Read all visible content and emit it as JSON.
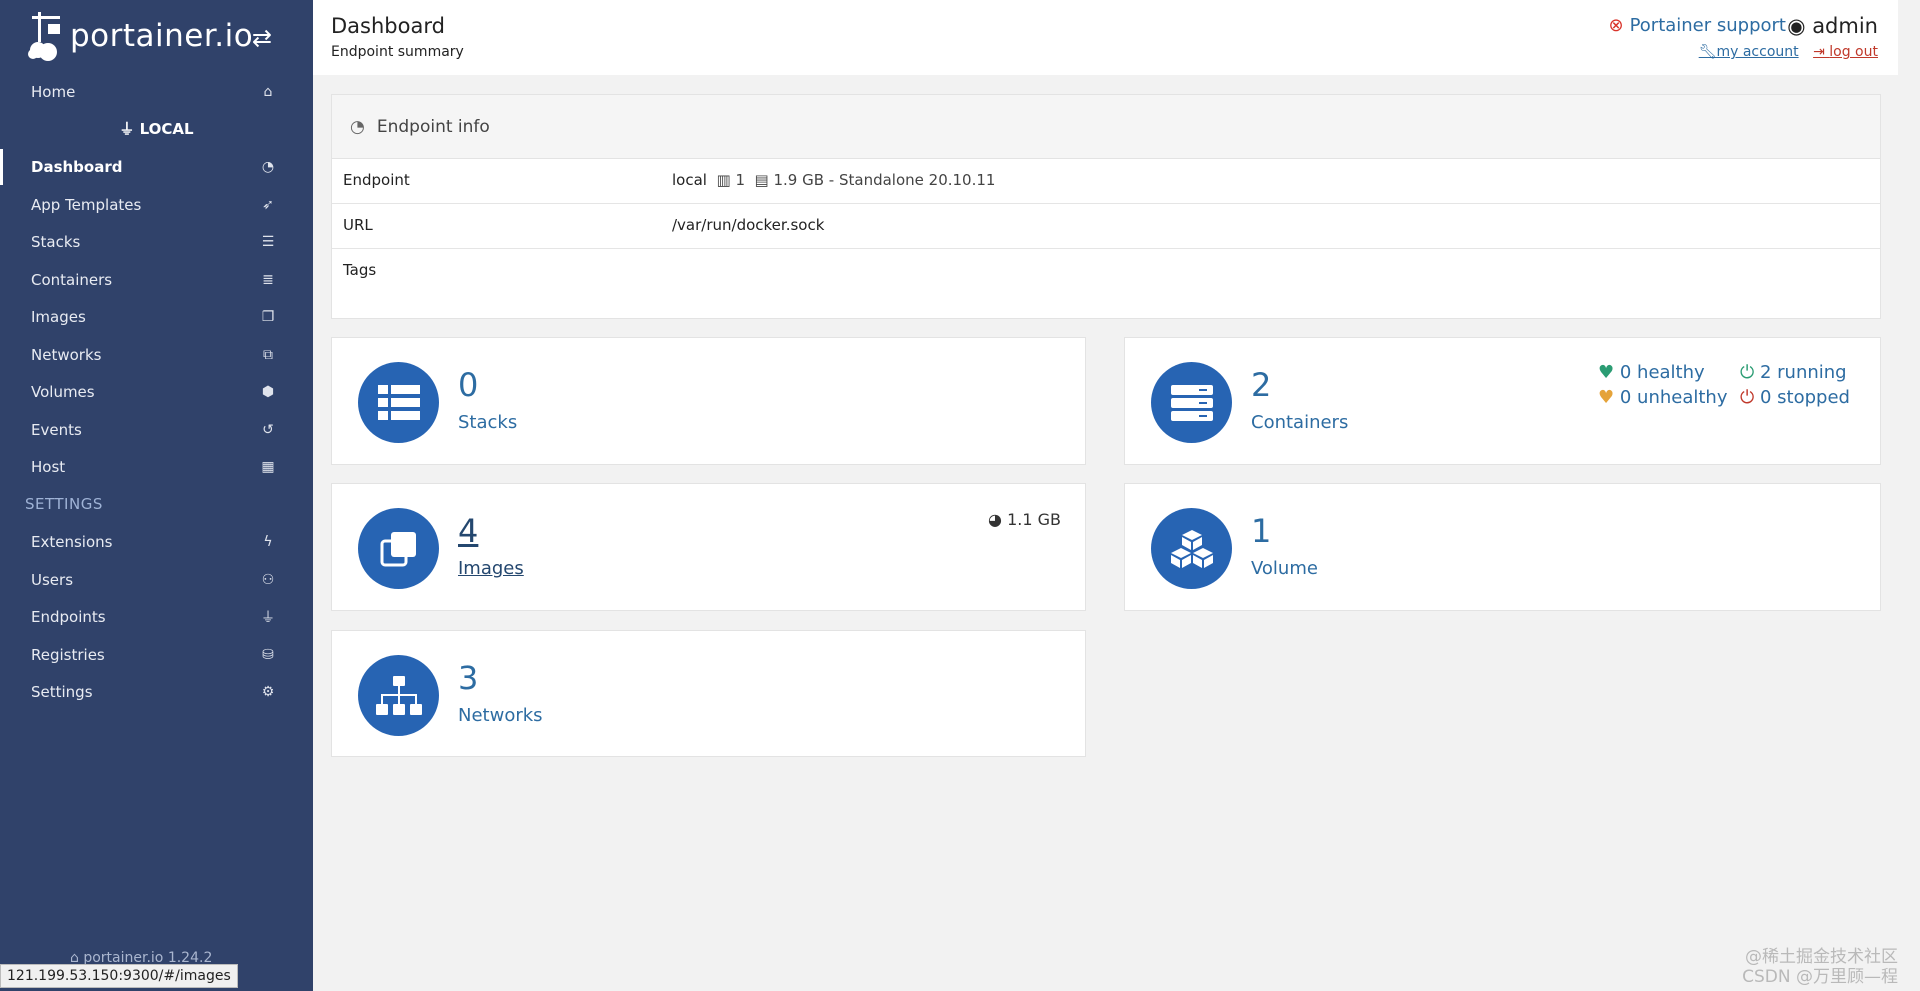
{
  "sidebar": {
    "brand": "portainer.io",
    "endpoint_label": "LOCAL",
    "items": [
      {
        "label": "Home",
        "icon": "home-icon",
        "glyph": "⌂"
      },
      {
        "label": "Dashboard",
        "icon": "tachometer-icon",
        "glyph": "◔",
        "active": true
      },
      {
        "label": "App Templates",
        "icon": "rocket-icon",
        "glyph": "➶"
      },
      {
        "label": "Stacks",
        "icon": "th-list-icon",
        "glyph": "☰"
      },
      {
        "label": "Containers",
        "icon": "server-icon",
        "glyph": "≣"
      },
      {
        "label": "Images",
        "icon": "clone-icon",
        "glyph": "❐"
      },
      {
        "label": "Networks",
        "icon": "sitemap-icon",
        "glyph": "⧉"
      },
      {
        "label": "Volumes",
        "icon": "cubes-icon",
        "glyph": "⬢"
      },
      {
        "label": "Events",
        "icon": "history-icon",
        "glyph": "↺"
      },
      {
        "label": "Host",
        "icon": "th-icon",
        "glyph": "▦"
      }
    ],
    "settings_title": "SETTINGS",
    "settings_items": [
      {
        "label": "Extensions",
        "icon": "bolt-icon",
        "glyph": "ϟ"
      },
      {
        "label": "Users",
        "icon": "users-icon",
        "glyph": "⚇"
      },
      {
        "label": "Endpoints",
        "icon": "plug-icon",
        "glyph": "⏚"
      },
      {
        "label": "Registries",
        "icon": "database-icon",
        "glyph": "⛁"
      },
      {
        "label": "Settings",
        "icon": "cogs-icon",
        "glyph": "⚙"
      }
    ],
    "version": "1.24.2"
  },
  "status_url": "121.199.53.150:9300/#/images",
  "header": {
    "title": "Dashboard",
    "subtitle": "Endpoint summary",
    "support": "Portainer support",
    "user": "admin",
    "my_account": "my account",
    "log_out": "log out"
  },
  "endpoint_info": {
    "title": "Endpoint info",
    "rows": {
      "endpoint_key": "Endpoint",
      "endpoint_name": "local",
      "cpu": "1",
      "memory_info": "1.9 GB - Standalone 20.10.11",
      "url_key": "URL",
      "url_value": "/var/run/docker.sock",
      "tags_key": "Tags"
    }
  },
  "cards": {
    "stacks": {
      "count": "0",
      "label": "Stacks"
    },
    "containers": {
      "count": "2",
      "label": "Containers",
      "healthy": "0 healthy",
      "running": "2 running",
      "unhealthy": "0 unhealthy",
      "stopped": "0 stopped"
    },
    "images": {
      "count": "4",
      "label": "Images",
      "size": "1.1 GB"
    },
    "volumes": {
      "count": "1",
      "label": "Volume"
    },
    "networks": {
      "count": "3",
      "label": "Networks"
    }
  },
  "watermark": {
    "line1": "@稀土掘金技术社区",
    "line2": "CSDN @万里顾—程"
  },
  "colors": {
    "sidebar": "#30426a",
    "accent": "#2764b3",
    "link": "#2d6ca2"
  }
}
